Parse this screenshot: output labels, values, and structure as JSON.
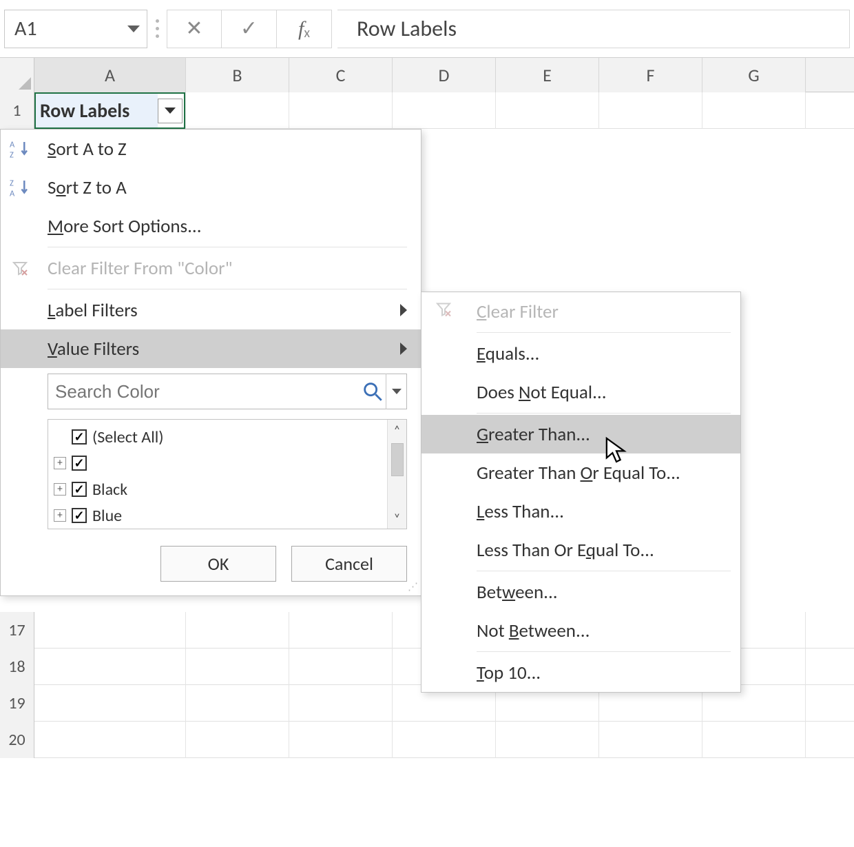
{
  "name_box": "A1",
  "formula_text": "Row Labels",
  "columns": [
    "A",
    "B",
    "C",
    "D",
    "E",
    "F",
    "G"
  ],
  "visible_rows_after_menu": [
    "17",
    "18",
    "19",
    "20"
  ],
  "pivot_cell": {
    "row": "1",
    "label": "Row Labels"
  },
  "filter_menu": {
    "sort_az": "Sort A to Z",
    "sort_za": "Sort Z to A",
    "more_sort": "More Sort Options...",
    "clear_filter": "Clear Filter From \"Color\"",
    "label_filters": "Label Filters",
    "value_filters": "Value Filters",
    "search_placeholder": "Search Color",
    "items": [
      {
        "label": "(Select All)",
        "checked": true,
        "expandable": false
      },
      {
        "label": "",
        "checked": true,
        "expandable": true
      },
      {
        "label": "Black",
        "checked": true,
        "expandable": true
      },
      {
        "label": "Blue",
        "checked": true,
        "expandable": true
      }
    ],
    "ok": "OK",
    "cancel": "Cancel"
  },
  "value_filters_submenu": {
    "clear_filter": "Clear Filter",
    "equals": "Equals...",
    "not_equal": "Does Not Equal...",
    "greater_than": "Greater Than...",
    "gte": "Greater Than Or Equal To...",
    "less_than": "Less Than...",
    "lte": "Less Than Or Equal To...",
    "between": "Between...",
    "not_between": "Not Between...",
    "top10": "Top 10..."
  }
}
